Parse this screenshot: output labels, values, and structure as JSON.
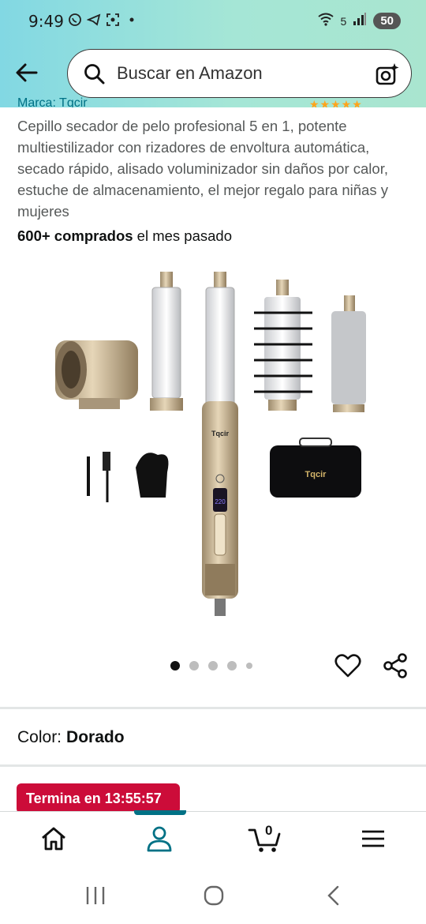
{
  "status": {
    "time": "9:49",
    "battery": "50",
    "signal_label": "5"
  },
  "search": {
    "placeholder": "Buscar en Amazon"
  },
  "product": {
    "partial_brand": "Marca: Tqcir",
    "title": "Cepillo secador de pelo profesional 5 en 1, potente multiestilizador con rizadores de envoltura automática, secado rápido, alisado voluminizador sin daños por calor, estuche de almacenamiento, el mejor regalo para niñas y mujeres",
    "bought_bold": "600+ comprados",
    "bought_rest": " el mes pasado",
    "image_brand": "Tqcir",
    "case_brand": "Tqcir",
    "display_reading": "220"
  },
  "carousel": {
    "count": 5,
    "active": 1
  },
  "color": {
    "label": "Color:",
    "value": "Dorado"
  },
  "deal": {
    "text": "Termina en 13:55:57"
  },
  "nav": {
    "cart_count": "0",
    "items": [
      "home-icon",
      "profile-icon",
      "cart-icon",
      "menu-icon"
    ]
  },
  "colors": {
    "header_from": "#82d8e3",
    "header_to": "#a9e5cf",
    "deal": "#cc0c39",
    "accent": "#007185"
  }
}
